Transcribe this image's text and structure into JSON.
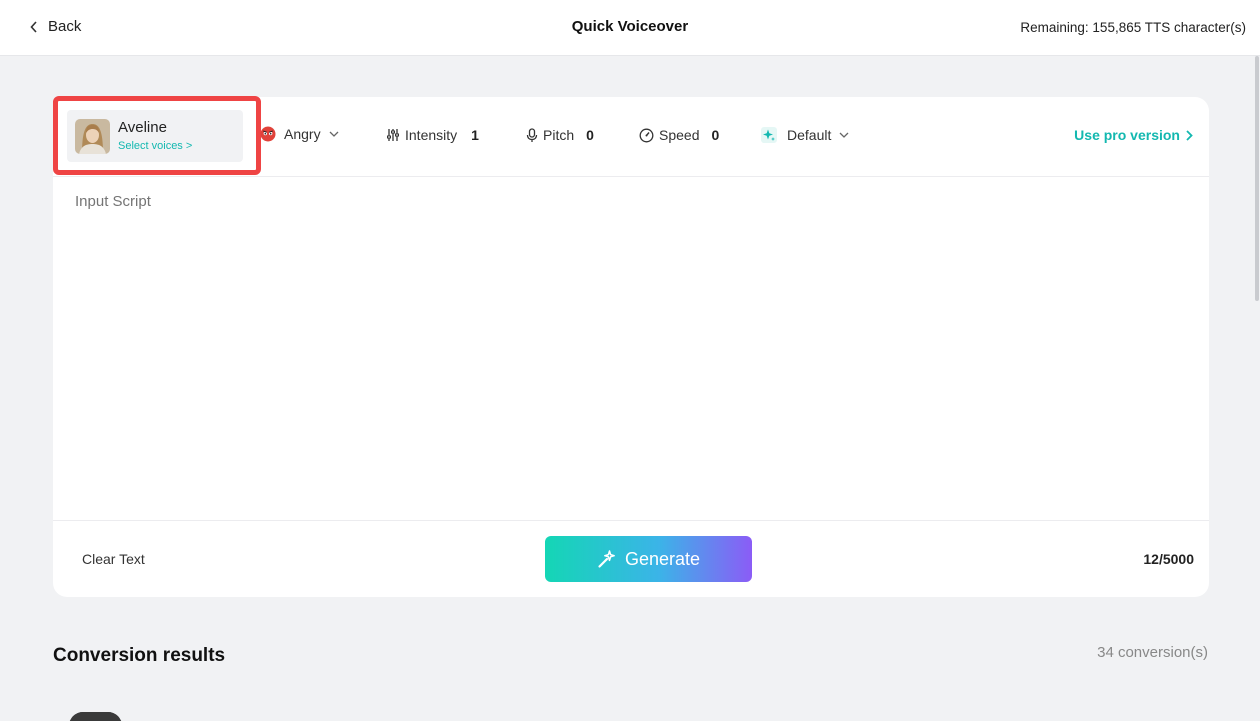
{
  "header": {
    "back_label": "Back",
    "title": "Quick Voiceover",
    "remaining": "Remaining: 155,865 TTS character(s)"
  },
  "voice": {
    "name": "Aveline",
    "select_label": "Select voices >"
  },
  "emotion": {
    "label": "Angry",
    "icon": "angry-face-icon"
  },
  "params": {
    "intensity": {
      "label": "Intensity",
      "value": "1"
    },
    "pitch": {
      "label": "Pitch",
      "value": "0"
    },
    "speed": {
      "label": "Speed",
      "value": "0"
    }
  },
  "style": {
    "label": "Default"
  },
  "pro_link": "Use pro version",
  "editor": {
    "placeholder": "Input Script"
  },
  "actions": {
    "clear_label": "Clear Text",
    "generate_label": "Generate",
    "char_count": "12/5000"
  },
  "results": {
    "title": "Conversion results",
    "count": "34 conversion(s)"
  },
  "colors": {
    "accent": "#13b8b0",
    "highlight": "#ef4444",
    "gradient_start": "#14d6b5",
    "gradient_end": "#8b5cf6",
    "background": "#f1f2f4"
  }
}
